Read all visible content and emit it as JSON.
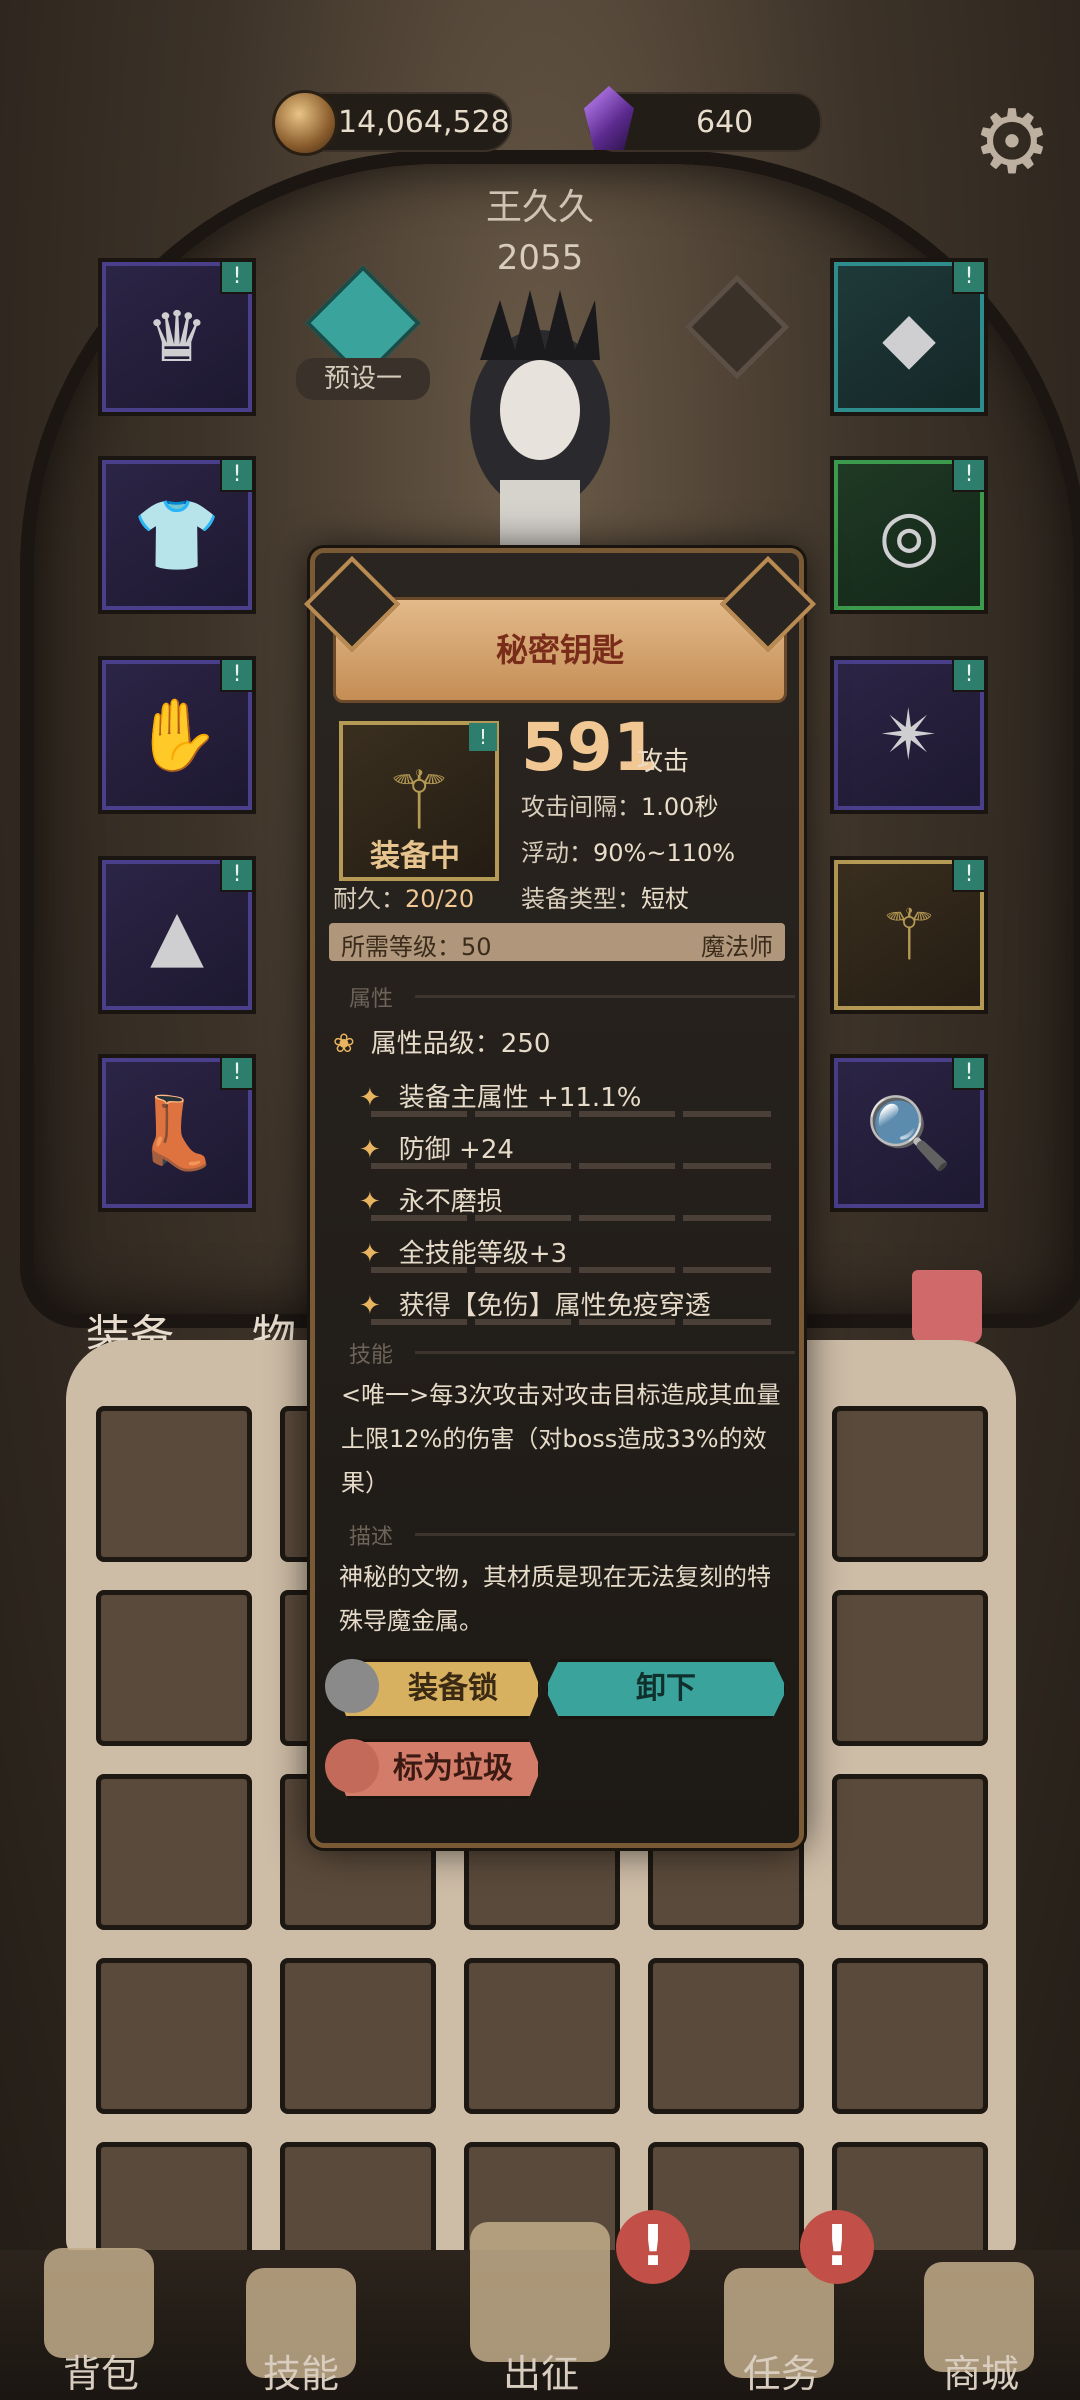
{
  "currency": {
    "gold": "14,064,528",
    "gems": "640"
  },
  "player": {
    "name": "王久久",
    "power": "2055"
  },
  "preset": {
    "label": "预设一"
  },
  "tabs": {
    "equipment": "装备",
    "items": "物"
  },
  "item": {
    "name": "秘密钥匙",
    "tag": "!",
    "equipped_label": "装备中",
    "attack_value": "591",
    "attack_unit": "攻击",
    "attack_interval": {
      "label": "攻击间隔：",
      "value": "1.00秒"
    },
    "float": {
      "label": "浮动：",
      "value": "90%~110%"
    },
    "durability": {
      "label": "耐久：",
      "value": "20/20"
    },
    "equip_type": {
      "label": "装备类型：",
      "value": "短杖"
    },
    "required_level": "所需等级：50",
    "class": "魔法师",
    "section_attributes": "属性",
    "attribute_grade": "属性品级：250",
    "attributes": [
      "装备主属性 +11.1%",
      "防御 +24",
      "永不磨损",
      "全技能等级+3",
      "获得【免伤】属性免疫穿透"
    ],
    "section_skill": "技能",
    "skill_text": "<唯一>每3次攻击对攻击目标造成其血量上限12%的伤害（对boss造成33%的效果）",
    "section_description": "描述",
    "description": "神秘的文物，其材质是现在无法复刻的特殊导魔金属。",
    "buttons": {
      "lock": "装备锁",
      "unequip": "卸下",
      "mark_trash": "标为垃圾"
    }
  },
  "nav": [
    "背包",
    "技能",
    "出征",
    "任务",
    "商城"
  ],
  "alerts": {
    "symbol": "!"
  },
  "colors": {
    "gold_text": "#f1c894",
    "teal": "#3aa39b",
    "title_red": "#7a2c1a"
  }
}
